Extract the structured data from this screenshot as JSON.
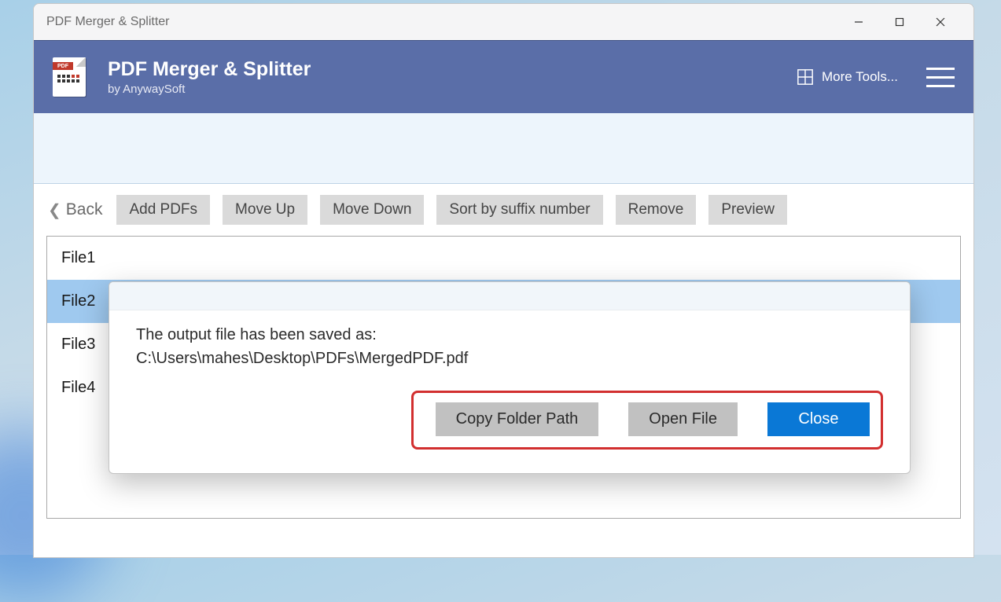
{
  "window": {
    "title": "PDF Merger & Splitter"
  },
  "app": {
    "title": "PDF Merger & Splitter",
    "subtitle": "by AnywaySoft",
    "more_tools_label": "More Tools...",
    "logo_band": "PDF"
  },
  "toolbar": {
    "back": "Back",
    "buttons": [
      "Add PDFs",
      "Move Up",
      "Move Down",
      "Sort by suffix number",
      "Remove",
      "Preview"
    ]
  },
  "files": [
    {
      "name": "File1",
      "selected": false
    },
    {
      "name": "File2",
      "selected": true
    },
    {
      "name": "File3",
      "selected": false
    },
    {
      "name": "File4",
      "selected": false
    }
  ],
  "dialog": {
    "message_line1": "The output file has been saved as:",
    "message_line2": "C:\\Users\\mahes\\Desktop\\PDFs\\MergedPDF.pdf",
    "copy_button": "Copy Folder Path",
    "open_button": "Open File",
    "close_button": "Close"
  }
}
